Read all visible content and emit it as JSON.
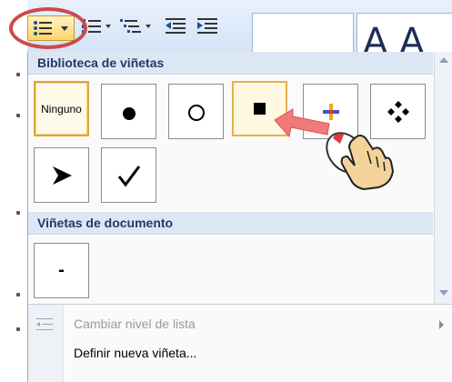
{
  "ribbon": {
    "buttons": [
      "bullets-button",
      "numbering-button",
      "multilevel-list-button",
      "decrease-indent-button",
      "increase-indent-button"
    ],
    "style_preview_text": "A",
    "style_preview_text2": "A A"
  },
  "gallery": {
    "section1_title": "Biblioteca de viñetas",
    "section2_title": "Viñetas de documento",
    "library": [
      {
        "label": "Ninguno",
        "icon": "none"
      },
      {
        "label": "",
        "icon": "filled-circle-icon"
      },
      {
        "label": "",
        "icon": "hollow-circle-icon"
      },
      {
        "label": "",
        "icon": "filled-square-icon"
      },
      {
        "label": "",
        "icon": "color-cross-icon"
      },
      {
        "label": "",
        "icon": "diamond-cluster-icon"
      },
      {
        "label": "",
        "icon": "arrowhead-icon"
      },
      {
        "label": "",
        "icon": "checkmark-icon"
      }
    ],
    "document_bullets": [
      {
        "label": "-",
        "icon": "dash-icon"
      }
    ]
  },
  "menu": {
    "change_level": "Cambiar nivel de lista",
    "define_new": "Definir nueva viñeta..."
  },
  "colors": {
    "header_text": "#1f3a6b",
    "selection_border": "#e0a63a",
    "annotation_red": "#cc4a4a"
  }
}
